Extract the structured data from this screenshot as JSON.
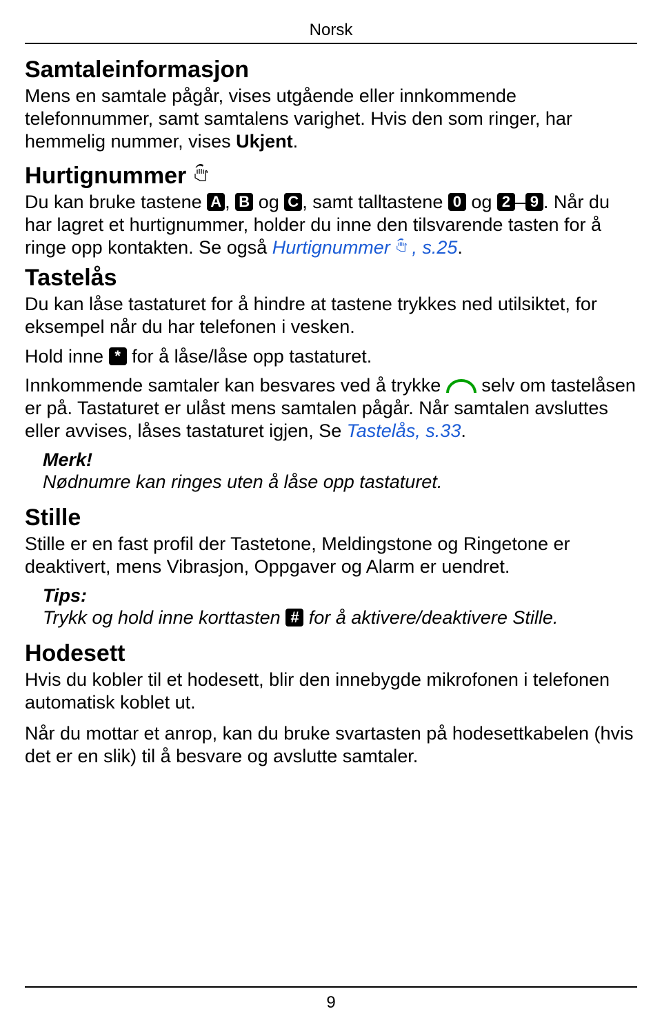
{
  "header": {
    "language": "Norsk"
  },
  "section1": {
    "title": "Samtaleinformasjon",
    "p1a": "Mens en samtale pågår, vises utgående eller innkommende telefonnummer, samt samtalens varighet. Hvis den som ringer, har hemmelig nummer, vises ",
    "p1b": "Ukjent",
    "p1c": "."
  },
  "section2": {
    "title": "Hurtignummer",
    "p1a": "Du kan bruke tastene ",
    "p1b": ", ",
    "p1c": " og ",
    "p1d": ", samt talltastene ",
    "p1e": " og ",
    "p1f": "–",
    "p1g": ". Når du har lagret et hurtignummer, holder du inne den tilsvarende tasten for å ringe opp kontakten. Se også ",
    "refText": "Hurtignummer ",
    "refPage": ", s.25",
    "p1h": "."
  },
  "section3": {
    "title": "Tastelås",
    "p1": "Du kan låse tastaturet for å hindre at tastene trykkes ned utilsiktet, for eksempel når du har telefonen i vesken.",
    "p2a": "Hold inne ",
    "p2b": " for å låse/låse opp tastaturet.",
    "p3a": "Innkommende samtaler kan besvares ved å trykke ",
    "p3b": " selv om tastelåsen er på. Tastaturet er ulåst mens samtalen pågår. Når samtalen avsluttes eller avvises, låses tastaturet igjen, Se ",
    "ref": "Tastelås, s.33",
    "p3c": "."
  },
  "note1": {
    "label": "Merk!",
    "body": "Nødnumre kan ringes uten å låse opp tastaturet."
  },
  "section4": {
    "title": "Stille",
    "p1": "Stille er en fast profil der Tastetone, Meldingstone og Ringetone er deaktivert, mens Vibrasjon, Oppgaver og Alarm er uendret."
  },
  "note2": {
    "label": "Tips:",
    "body1": "Trykk og hold inne korttasten ",
    "body2": " for å aktivere/deaktivere Stille."
  },
  "section5": {
    "title": "Hodesett",
    "p1": "Hvis du kobler til et hodesett, blir den innebygde mikrofonen i telefonen automatisk koblet ut.",
    "p2": "Når du mottar et anrop, kan du bruke svartasten på hodesettkabelen (hvis det er en slik) til å besvare og avslutte samtaler."
  },
  "keys": {
    "A": "A",
    "B": "B",
    "C": "C",
    "zero": "0",
    "two": "2",
    "nine": "9",
    "star": "*",
    "hash": "#"
  },
  "footer": {
    "pageNumber": "9"
  }
}
